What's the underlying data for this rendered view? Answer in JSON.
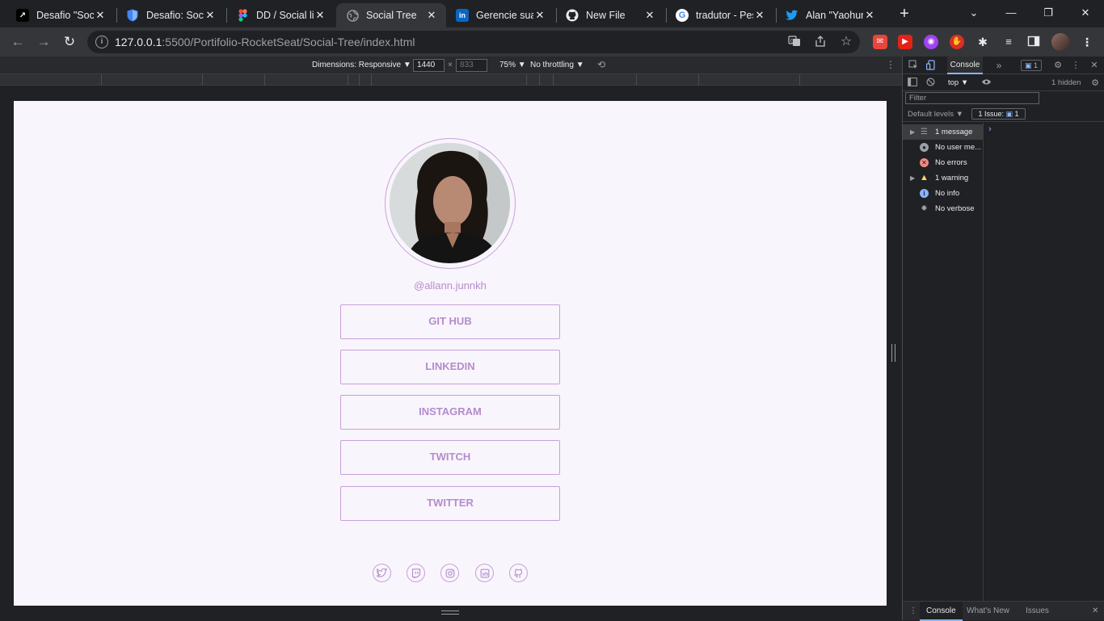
{
  "browser": {
    "tabs": [
      {
        "title": "Desafio \"Soci",
        "favicon": "rocketseat-icon",
        "color": "#000000",
        "glyph": "↗"
      },
      {
        "title": "Desafio: Socia",
        "favicon": "shield-icon",
        "color": "#4285f4",
        "glyph": "⛉"
      },
      {
        "title": "DD / Social lin",
        "favicon": "figma-icon",
        "color": "#f24e1e",
        "glyph": "F"
      },
      {
        "title": "Social Tree",
        "favicon": "globe-icon",
        "color": "#9aa0a6",
        "glyph": "◍"
      },
      {
        "title": "Gerencie sua",
        "favicon": "linkedin-icon",
        "color": "#0a66c2",
        "glyph": "in"
      },
      {
        "title": "New File",
        "favicon": "github-icon",
        "color": "#202124",
        "glyph": "●"
      },
      {
        "title": "tradutor - Pes",
        "favicon": "google-icon",
        "color": "#ffffff",
        "glyph": "G"
      },
      {
        "title": "Alan \"Yaohura",
        "favicon": "twitter-icon",
        "color": "#1d9bf0",
        "glyph": "✦"
      }
    ],
    "url_host": "127.0.0.1",
    "url_path": ":5500/Portifolio-RocketSeat/Social-Tree/index.html"
  },
  "device_toolbar": {
    "dimensions_label": "Dimensions: Responsive ▼",
    "width": "1440",
    "height": "833",
    "times": "×",
    "zoom": "75% ▼",
    "throttling": "No throttling ▼"
  },
  "page": {
    "handle": "@allann.junnkh",
    "links": [
      "GIT HUB",
      "LINKEDIN",
      "INSTAGRAM",
      "TWITCH",
      "TWITTER"
    ],
    "accent": "#b48ccc",
    "background": "#f9f5fc"
  },
  "devtools": {
    "tab_console": "Console",
    "more": "»",
    "badge": "1",
    "context": "top ▼",
    "hidden": "1 hidden",
    "filter_placeholder": "Filter",
    "levels": "Default levels ▼",
    "issues": "1 Issue:",
    "issues_count": "1",
    "sidebar": [
      {
        "label": "1 message",
        "icon": "list-icon",
        "expandable": true
      },
      {
        "label": "No user me...",
        "icon": "user-icon",
        "expandable": false
      },
      {
        "label": "No errors",
        "icon": "error-icon",
        "expandable": false
      },
      {
        "label": "1 warning",
        "icon": "warning-icon",
        "expandable": true
      },
      {
        "label": "No info",
        "icon": "info-icon",
        "expandable": false
      },
      {
        "label": "No verbose",
        "icon": "verbose-icon",
        "expandable": false
      }
    ],
    "prompt": "›",
    "bottom_tabs": [
      "Console",
      "What's New",
      "Issues"
    ]
  }
}
